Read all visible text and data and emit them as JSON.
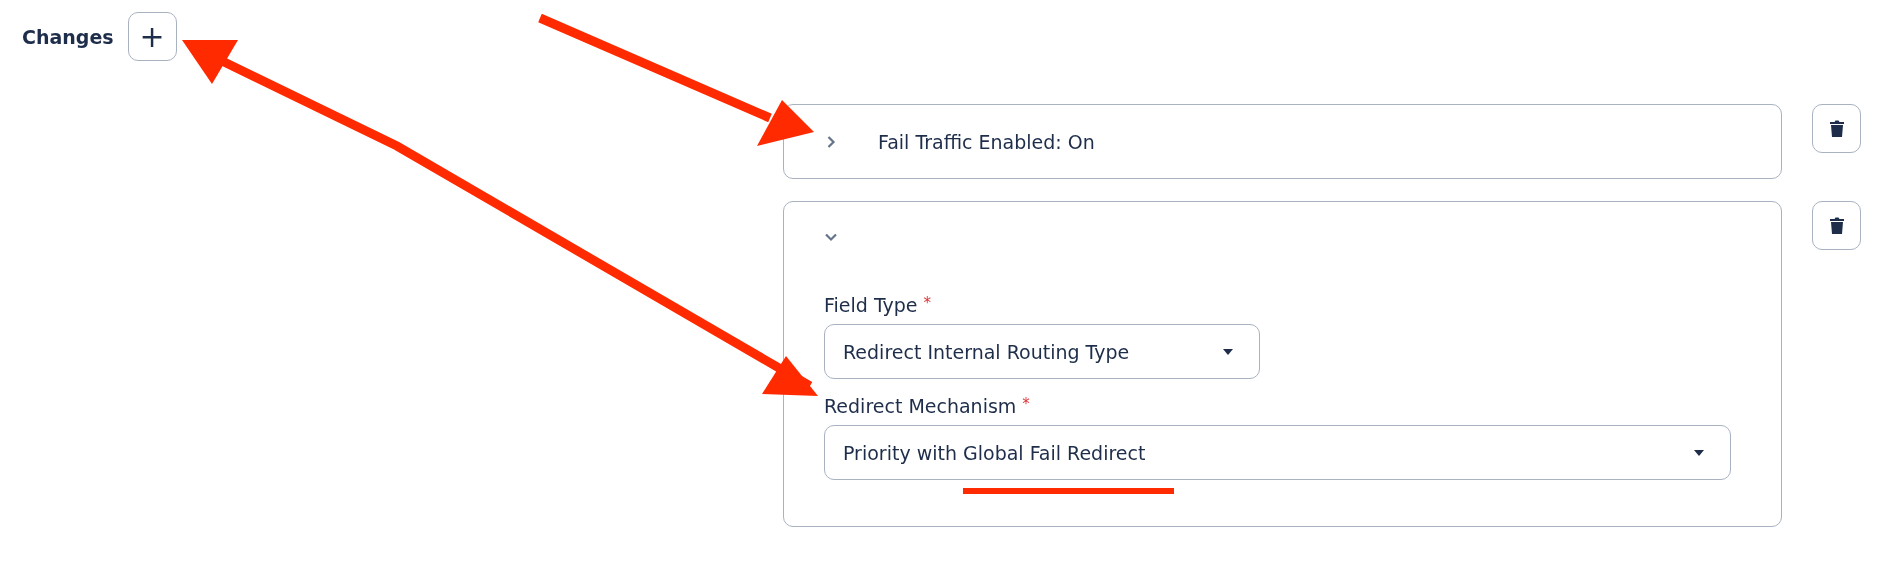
{
  "section": {
    "title": "Changes",
    "add_button": "+"
  },
  "changes": [
    {
      "expanded": false,
      "summary": "Fail Traffic Enabled: On"
    },
    {
      "expanded": true,
      "fields": [
        {
          "label": "Field Type",
          "required_mark": "*",
          "value": "Redirect Internal Routing Type"
        },
        {
          "label": "Redirect Mechanism",
          "required_mark": "*",
          "value": "Priority with Global Fail Redirect"
        }
      ]
    }
  ]
}
